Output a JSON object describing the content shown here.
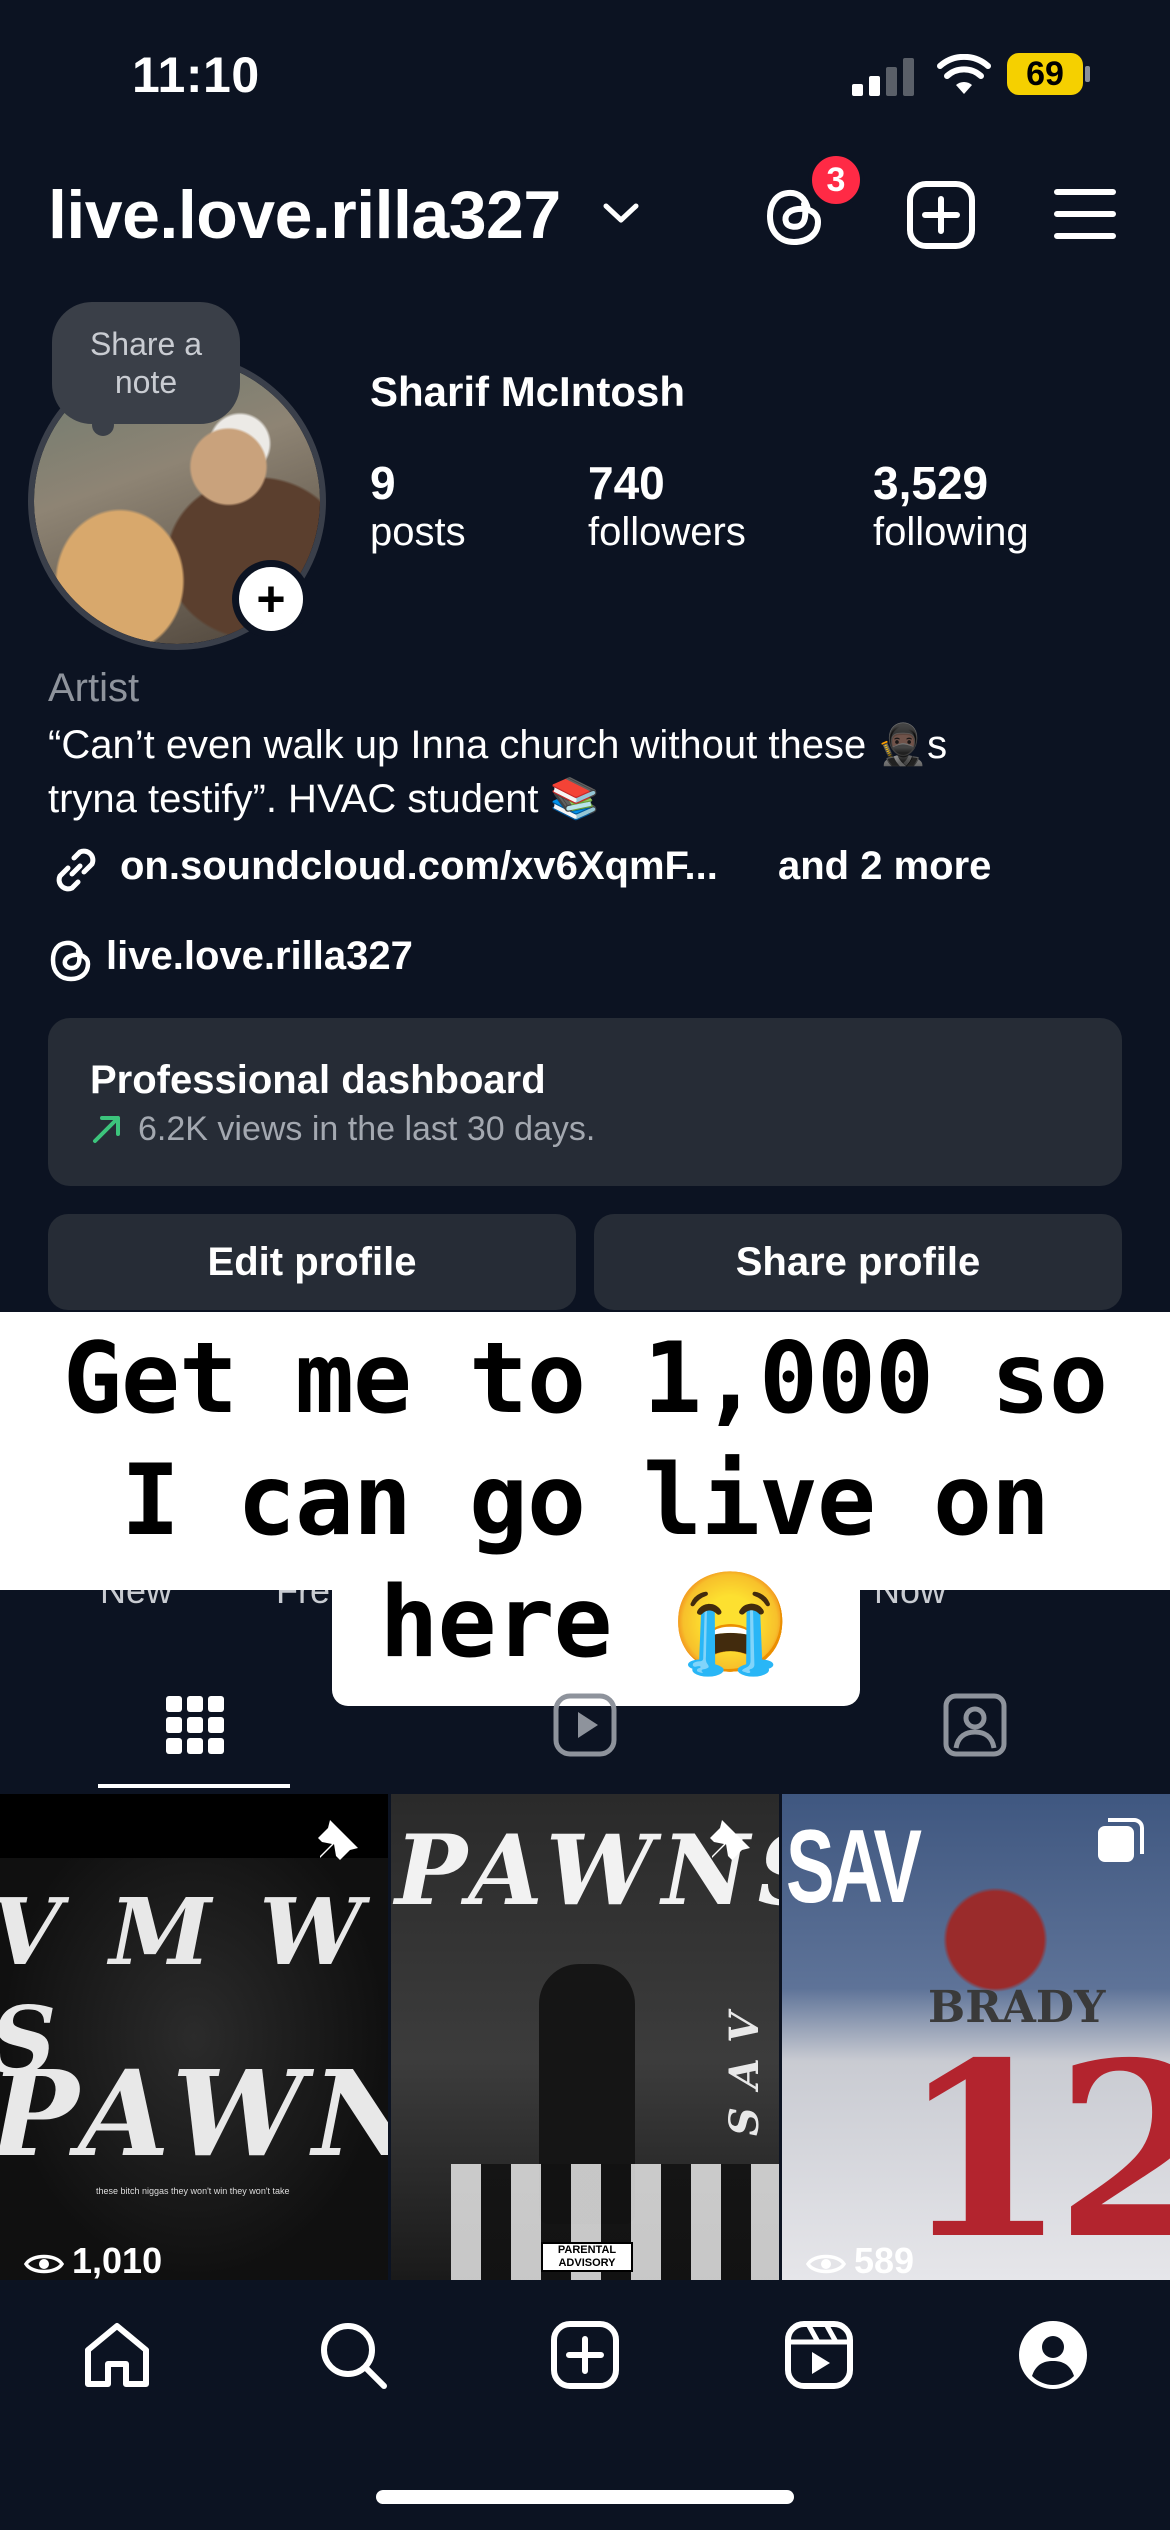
{
  "status_bar": {
    "time": "11:10",
    "battery": "69"
  },
  "header": {
    "username": "live.love.rilla327",
    "threads_badge": "3"
  },
  "note": {
    "text": "Share a note"
  },
  "profile": {
    "full_name": "Sharif McIntosh",
    "stats": [
      {
        "value": "9",
        "label": "posts"
      },
      {
        "value": "740",
        "label": "followers"
      },
      {
        "value": "3,529",
        "label": "following"
      }
    ],
    "category": "Artist",
    "bio_line1": "“Can’t even walk up Inna church without these 🥷🏿s",
    "bio_line2": "tryna testify”. HVAC student 📚",
    "link": "on.soundcloud.com/xv6XqmF...",
    "link_more": "and 2 more",
    "threads_handle": "live.love.rilla327"
  },
  "dashboard": {
    "title": "Professional dashboard",
    "subtitle": "6.2K views in the last 30 days."
  },
  "buttons": {
    "edit": "Edit profile",
    "share": "Share profile"
  },
  "highlights": [
    "New",
    "Fre",
    "Now"
  ],
  "caption": {
    "line1": "Get me to 1,000 so",
    "line2": "I can go live on",
    "line3": "here 😭"
  },
  "grid": [
    {
      "text_top": "V M W S",
      "text_main": "PAWNS",
      "small_text": "these bitch niggas they won't win they won't take",
      "views": "1,010",
      "pinned": true
    },
    {
      "text_main": "PAWNS",
      "side_text": "SAV",
      "label": "PARENTAL ADVISORY",
      "pinned": true
    },
    {
      "text_main": "SAV",
      "jersey_name": "BRADY",
      "jersey_number": "12",
      "views": "589",
      "multi": true
    }
  ],
  "colors": {
    "background": "#0c1322",
    "card": "#262c36",
    "badge": "#ff2a45",
    "trend": "#3cc47c"
  }
}
